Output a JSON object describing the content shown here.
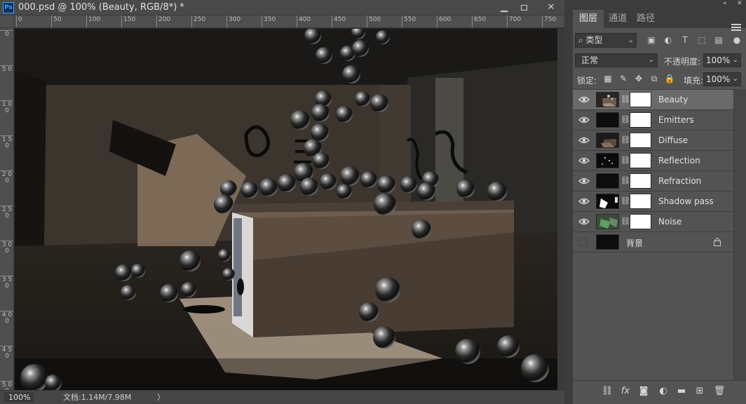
{
  "document": {
    "title": "000.psd @ 100% (Beauty, RGB/8*) *",
    "ps_logo": "Ps",
    "window_buttons": {
      "minimize": "▁",
      "close": "✕"
    },
    "ruler_h_ticks": [
      "0",
      "50",
      "100",
      "150",
      "200",
      "250",
      "300",
      "350",
      "400",
      "450",
      "500",
      "550",
      "600",
      "650",
      "700",
      "750"
    ],
    "ruler_v_ticks": [
      "0",
      "5 0",
      "1 0 0",
      "1 5 0",
      "2 0 0",
      "2 5 0",
      "3 0 0",
      "3 5 0",
      "4 0 0",
      "4 5 0",
      "5 0 0"
    ],
    "zoom": "100%",
    "doc_info": "文档:1.14M/7.98M",
    "status_arrow": "〉"
  },
  "panel": {
    "tabs": [
      "图层",
      "通道",
      "路径"
    ],
    "active_tab": "图层",
    "collapse_icon": "«",
    "collapse_icon2": "✕",
    "filter": {
      "label": "类型",
      "icon": "search-icon"
    },
    "blend_mode": "正常",
    "opacity_label": "不透明度:",
    "opacity_value": "100%",
    "lock_label": "锁定:",
    "fill_label": "填充:",
    "fill_value": "100%",
    "layers": [
      {
        "name": "Beauty",
        "visible": true,
        "selected": true,
        "thumb": "beauty"
      },
      {
        "name": "Emitters",
        "visible": true,
        "selected": false,
        "thumb": "black"
      },
      {
        "name": "Diffuse",
        "visible": true,
        "selected": false,
        "thumb": "diffuse"
      },
      {
        "name": "Reflection",
        "visible": true,
        "selected": false,
        "thumb": "reflection"
      },
      {
        "name": "Refraction",
        "visible": true,
        "selected": false,
        "thumb": "black"
      },
      {
        "name": "Shadow pass",
        "visible": true,
        "selected": false,
        "thumb": "shadow"
      },
      {
        "name": "Noise",
        "visible": true,
        "selected": false,
        "thumb": "noise"
      },
      {
        "name": "背景",
        "visible": false,
        "selected": false,
        "thumb": "black",
        "locked": true
      }
    ]
  },
  "colors": {
    "panel_bg": "#535353",
    "selected_layer": "#6a6a6a",
    "ps_blue": "#39a0ff"
  }
}
